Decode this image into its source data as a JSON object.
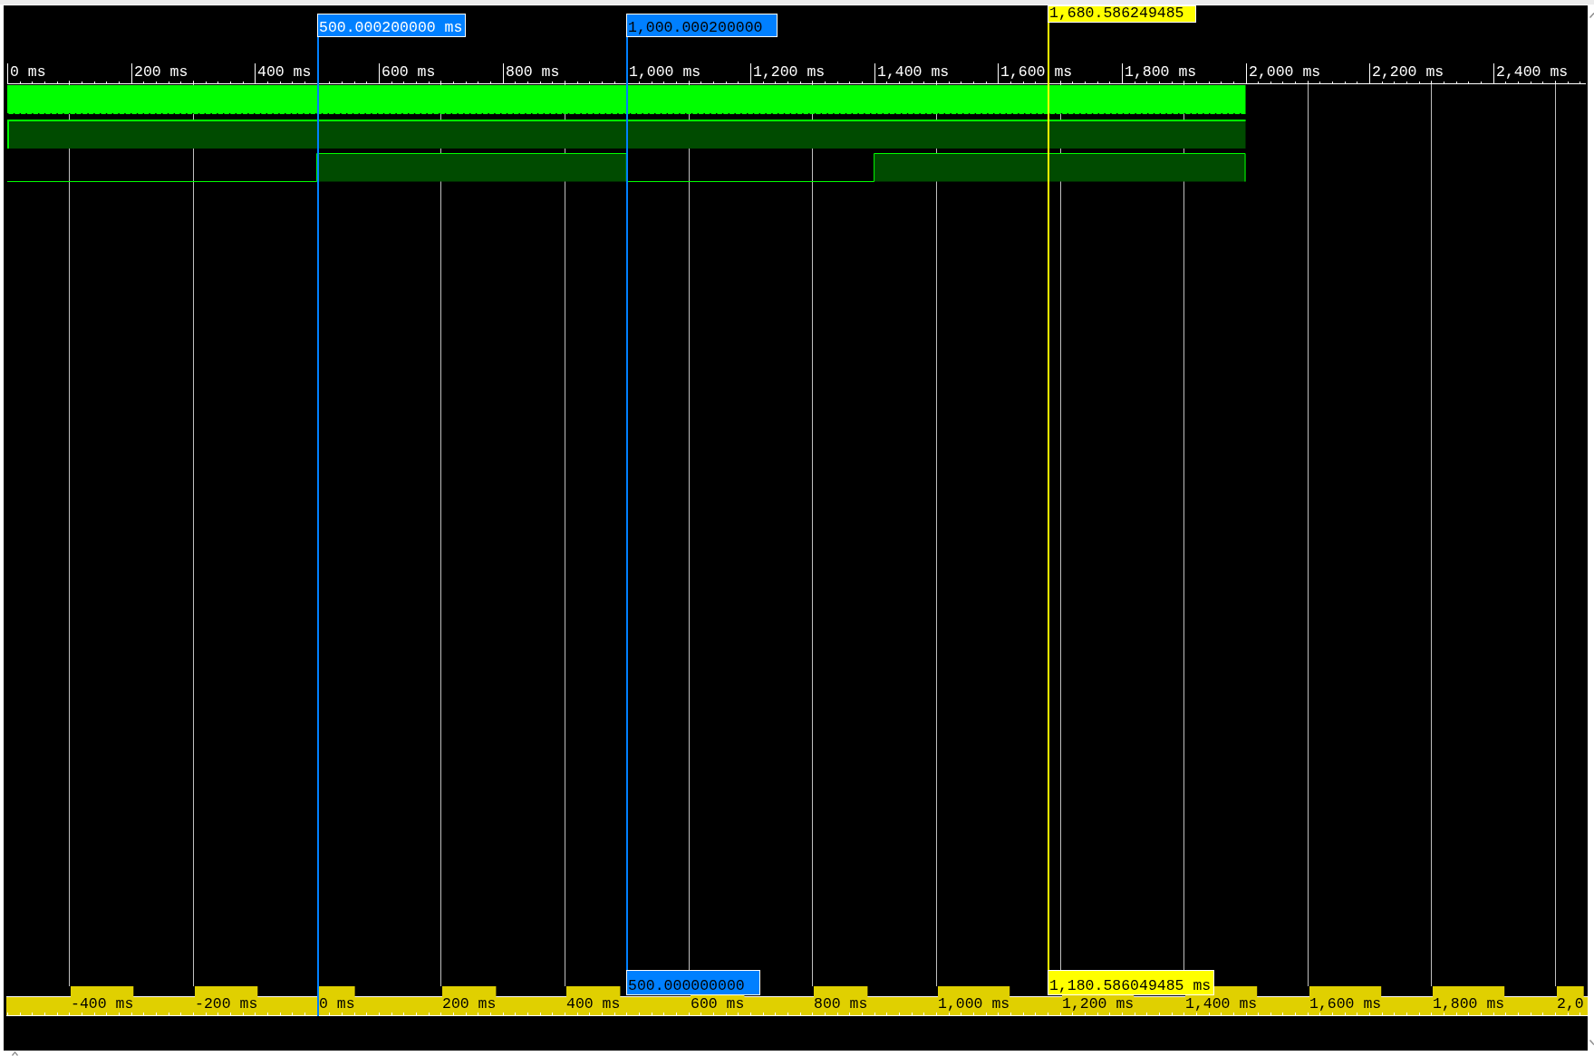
{
  "time_ruler": {
    "labels": [
      "0 ms",
      "200 ms",
      "400 ms",
      "600 ms",
      "800 ms",
      "1,000 ms",
      "1,200 ms",
      "1,400 ms",
      "1,600 ms",
      "1,800 ms",
      "2,000 ms",
      "2,200 ms",
      "2,400 ms"
    ]
  },
  "signals": [
    {
      "kind": "clock"
    },
    {
      "kind": "high"
    },
    {
      "kind": "pulse"
    }
  ],
  "cursors": [
    {
      "label": "500.000200000 ms",
      "color": "#0080ff",
      "selected": true
    },
    {
      "label": "1,000.000200000",
      "relative_label": "500.000000000",
      "color": "#0080ff",
      "selected": false
    },
    {
      "label": "1,680.586249485",
      "relative_label": "1,180.586049485 ms",
      "color": "#ffff00",
      "selected": false
    }
  ],
  "relative_ruler": {
    "labels": [
      "-400 ms",
      "-200 ms",
      "0 ms",
      "200 ms",
      "400 ms",
      "600 ms",
      "800 ms",
      "1,000 ms",
      "1,200 ms",
      "1,400 ms",
      "1,600 ms",
      "1,800 ms",
      "2,0"
    ]
  }
}
